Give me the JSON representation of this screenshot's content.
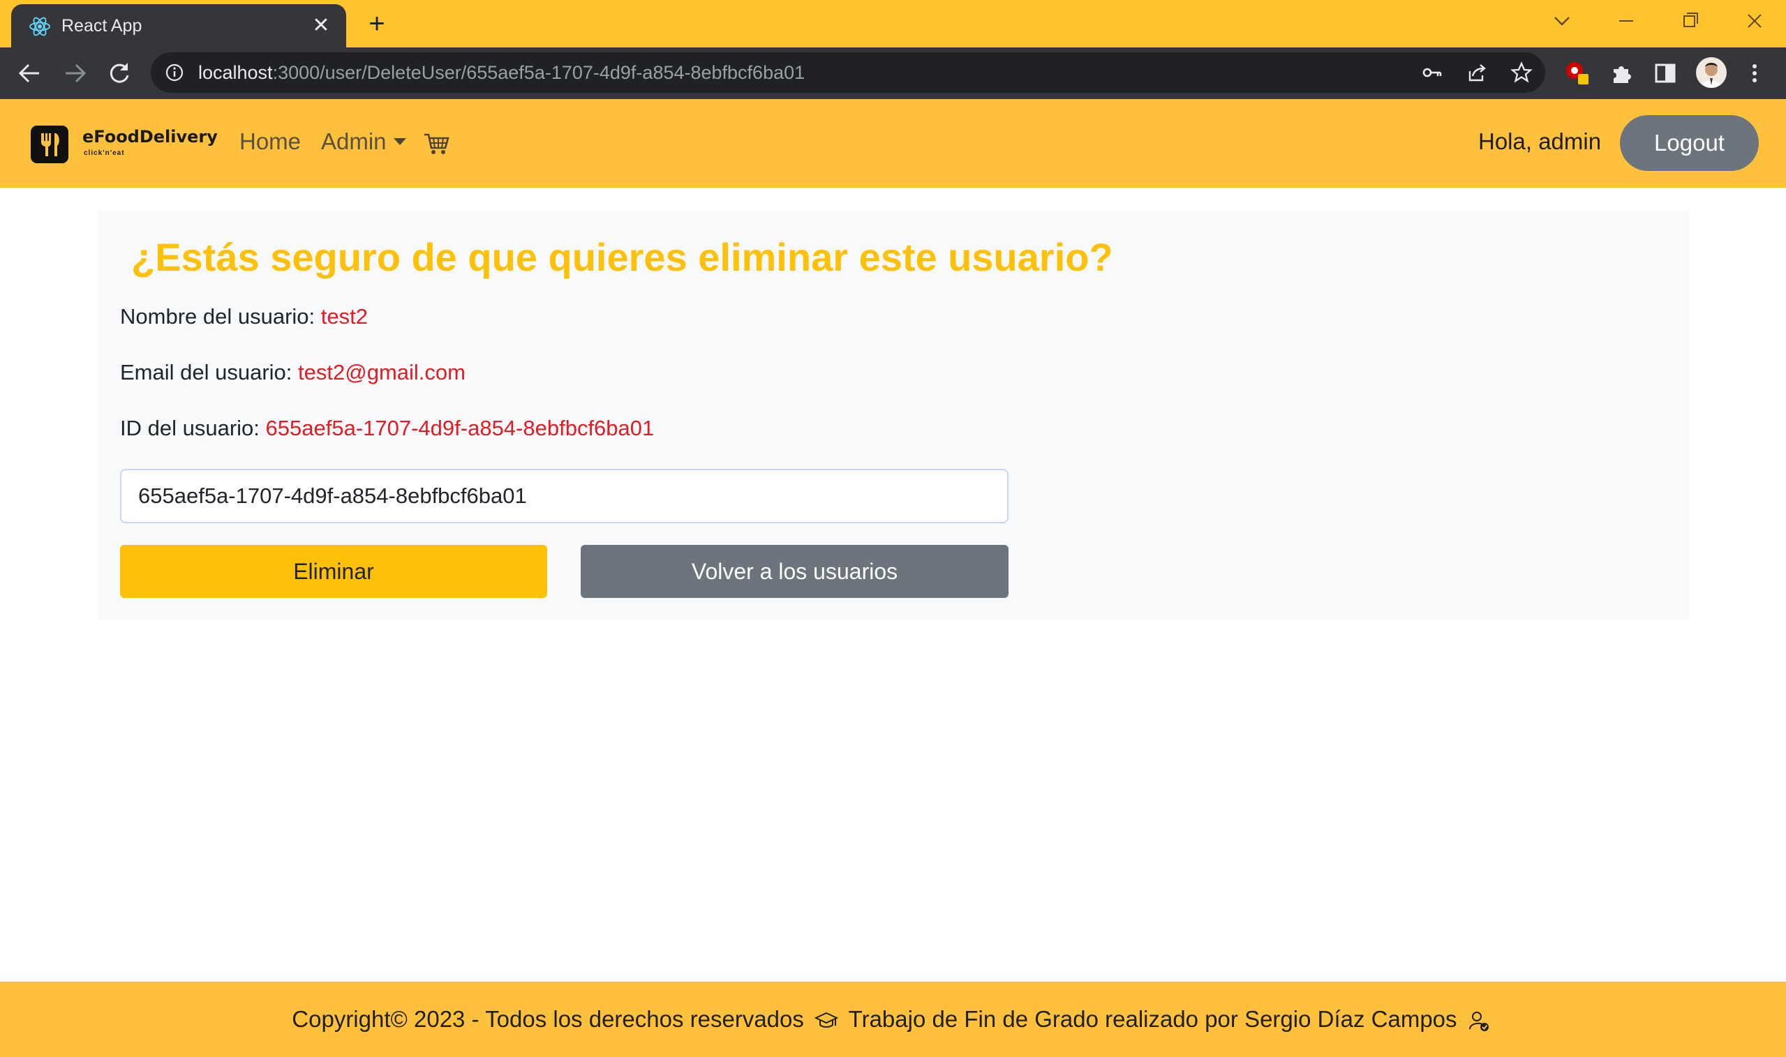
{
  "browser": {
    "tab_title": "React App",
    "tab_close": "✕",
    "new_tab": "+",
    "url_host": "localhost",
    "url_path": ":3000/user/DeleteUser/655aef5a-1707-4d9f-a854-8ebfbcf6ba01"
  },
  "navbar": {
    "brand_name": "eFoodDelivery",
    "brand_tagline": "click'n'eat",
    "home_label": "Home",
    "admin_label": "Admin",
    "greeting": "Hola, admin",
    "logout_label": "Logout"
  },
  "card": {
    "title": "¿Estás seguro de que quieres eliminar este usuario?",
    "name_label": "Nombre del usuario:",
    "name_value": "test2",
    "email_label": "Email del usuario:",
    "email_value": "test2@gmail.com",
    "id_label": "ID del usuario:",
    "id_value": "655aef5a-1707-4d9f-a854-8ebfbcf6ba01",
    "input_value": "655aef5a-1707-4d9f-a854-8ebfbcf6ba01",
    "delete_label": "Eliminar",
    "back_label": "Volver a los usuarios"
  },
  "footer": {
    "copyright": "Copyright© 2023 - Todos los derechos reservados",
    "credit": "Trabajo de Fin de Grado realizado por Sergio Díaz Campos"
  },
  "colors": {
    "brand_yellow": "#ffc13b",
    "warning": "#ffc107",
    "secondary": "#6c757d",
    "value_red": "#e31b23"
  },
  "icons": [
    "react-favicon-icon",
    "back-arrow-icon",
    "forward-arrow-icon",
    "reload-icon",
    "info-icon",
    "key-icon",
    "share-icon",
    "star-icon",
    "extension-badge-icon",
    "puzzle-icon",
    "sidepanel-icon",
    "profile-avatar",
    "menu-dots-icon",
    "fork-knife-logo-icon",
    "cart-icon",
    "graduation-cap-icon",
    "user-check-icon"
  ]
}
